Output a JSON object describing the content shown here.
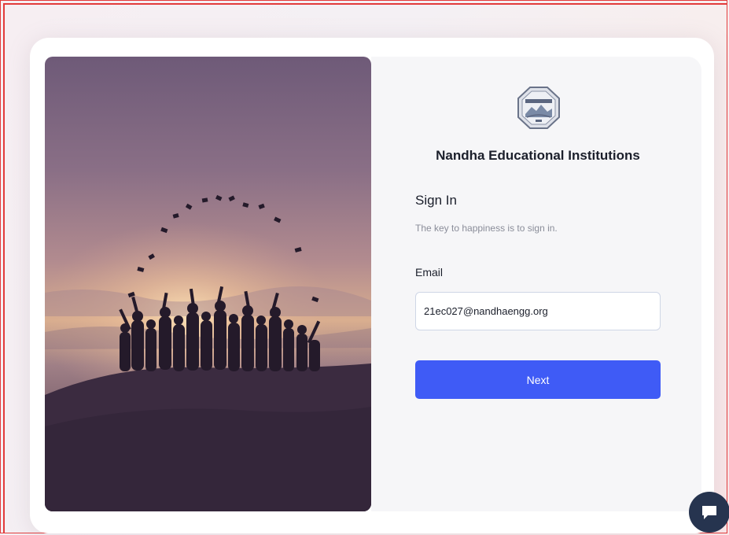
{
  "institution": {
    "name": "Nandha Educational Institutions",
    "logo_icon": "nandha-emblem-icon"
  },
  "signin": {
    "title": "Sign In",
    "subtitle": "The key to happiness is to sign in."
  },
  "email": {
    "label": "Email",
    "value": "21ec027@nandhaengg.org"
  },
  "actions": {
    "next_label": "Next"
  },
  "hero": {
    "image_icon": "graduates-silhouette-sunset-image"
  },
  "chat": {
    "icon": "chat-bubble-icon"
  },
  "colors": {
    "primary_button": "#3f5bf6",
    "chat_button": "#26344f",
    "heading_text": "#1b1f2b",
    "muted_text": "#8a8d99",
    "frame_border": "#e23b3b"
  }
}
